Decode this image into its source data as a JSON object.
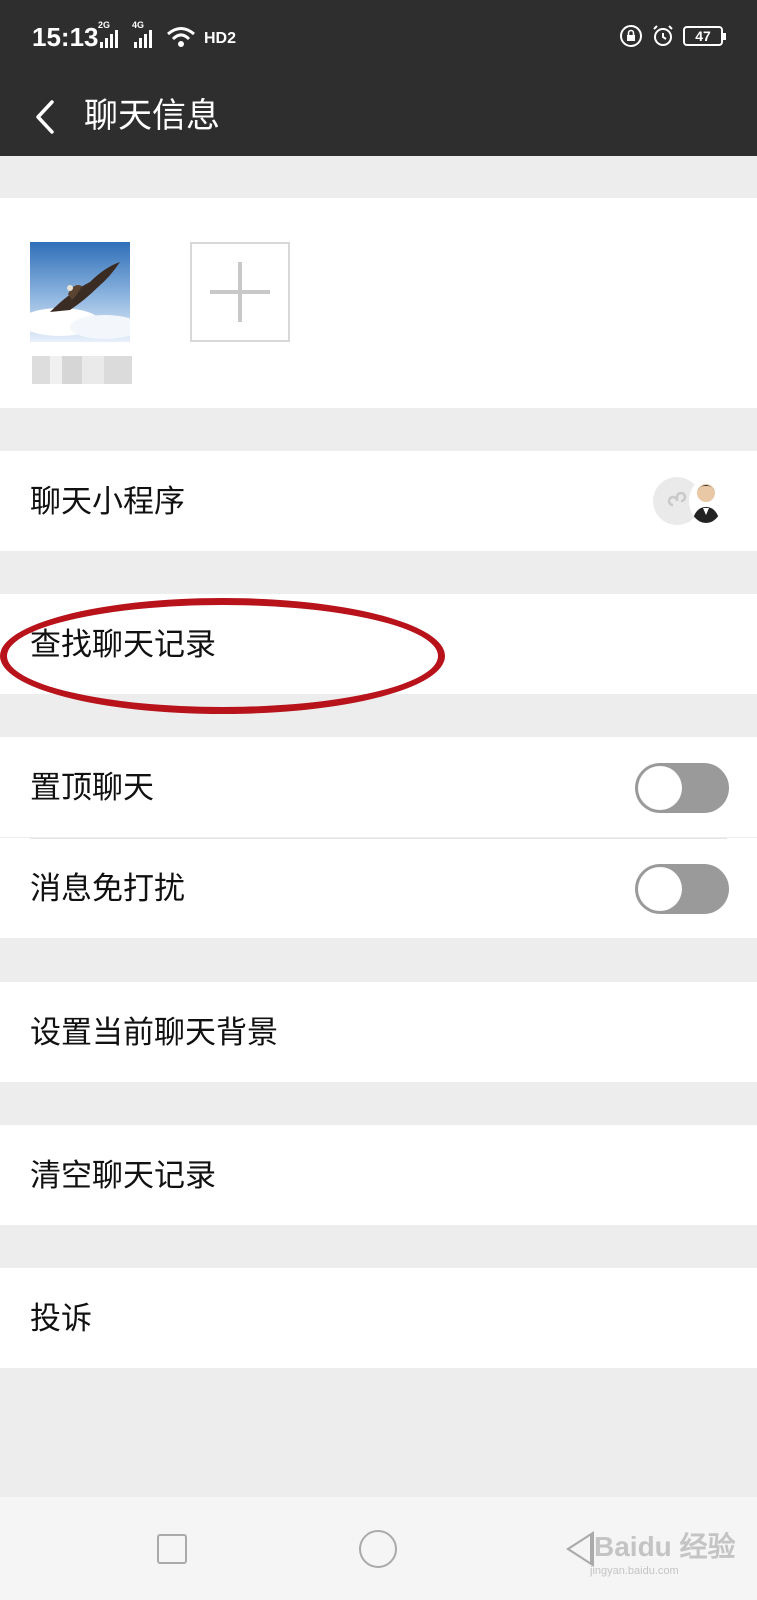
{
  "status_bar": {
    "time": "15:13",
    "sim1_label": "2G",
    "sim2_label": "4G",
    "hd_label": "HD2",
    "battery": "47"
  },
  "header": {
    "title": "聊天信息"
  },
  "members": {
    "add_icon": "plus-icon"
  },
  "settings": {
    "mini_programs": "聊天小程序",
    "search_history": "查找聊天记录",
    "pin_chat": {
      "label": "置顶聊天",
      "on": false
    },
    "mute_notifications": {
      "label": "消息免打扰",
      "on": false
    },
    "set_background": "设置当前聊天背景",
    "clear_history": "清空聊天记录",
    "report": "投诉"
  },
  "watermark": {
    "brand": "Baidu 经验",
    "url": "jingyan.baidu.com"
  },
  "colors": {
    "header_bg": "#2e2e2e",
    "page_bg": "#ededed",
    "toggle_off": "#9a9a9a",
    "annotation_red": "#b8121b"
  }
}
